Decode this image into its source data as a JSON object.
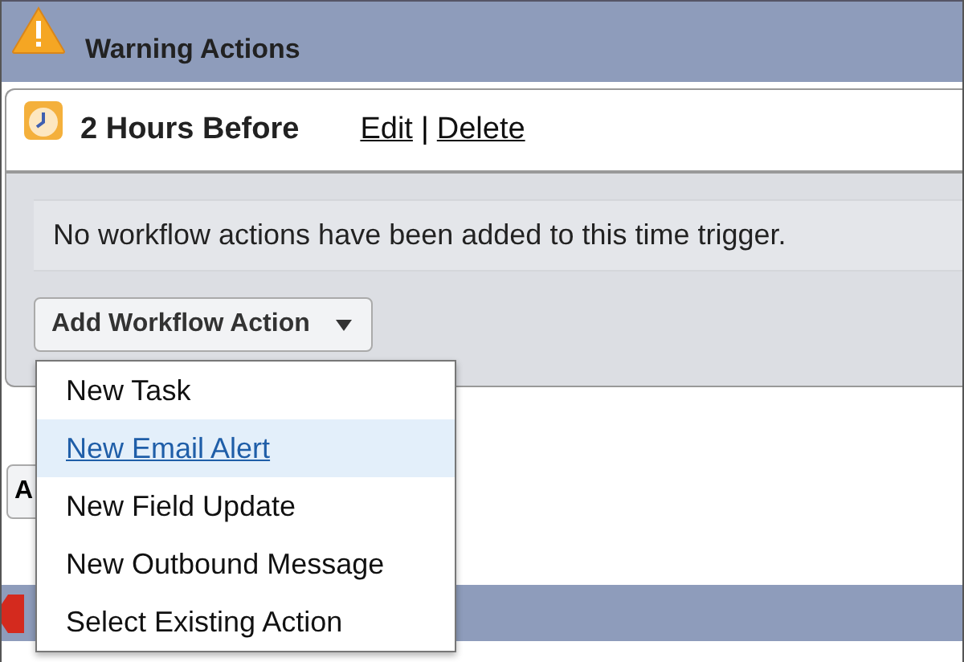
{
  "section": {
    "title": "Warning Actions"
  },
  "trigger": {
    "title": "2 Hours Before",
    "links": [
      "Edit",
      "Delete"
    ],
    "separator": "|",
    "message": "No workflow actions have been added to this time trigger.",
    "button": "Add Workflow Action"
  },
  "partial_button": {
    "label": "A"
  },
  "menu": [
    {
      "label": "New Task",
      "selected": false
    },
    {
      "label": "New Email Alert",
      "selected": true
    },
    {
      "label": "New Field Update",
      "selected": false
    },
    {
      "label": "New Outbound Message",
      "selected": false
    },
    {
      "label": "Select Existing Action",
      "selected": false
    }
  ]
}
